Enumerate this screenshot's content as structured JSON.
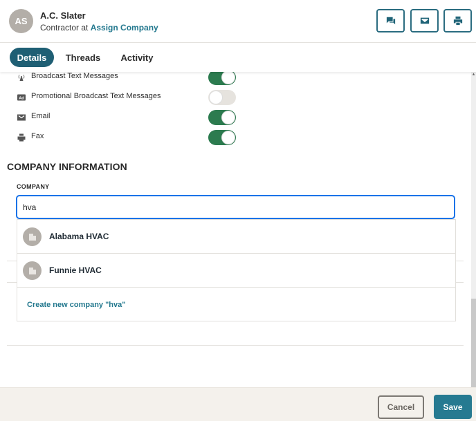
{
  "contact": {
    "initials": "AS",
    "name": "A.C. Slater",
    "role_prefix": "Contractor at ",
    "company_link": "Assign Company"
  },
  "header_actions": [
    {
      "name": "threads",
      "icon": "chat-icon"
    },
    {
      "name": "email",
      "icon": "envelope-icon"
    },
    {
      "name": "print",
      "icon": "printer-icon"
    }
  ],
  "tabs": [
    {
      "label": "Details",
      "active": true
    },
    {
      "label": "Threads",
      "active": false
    },
    {
      "label": "Activity",
      "active": false
    }
  ],
  "preferences": [
    {
      "label": "Broadcast Text Messages",
      "icon": "broadcast-icon",
      "enabled": true
    },
    {
      "label": "Promotional Broadcast Text Messages",
      "icon": "ad-icon",
      "enabled": false
    },
    {
      "label": "Email",
      "icon": "envelope-icon",
      "enabled": true
    },
    {
      "label": "Fax",
      "icon": "printer-icon",
      "enabled": true
    }
  ],
  "company_section": {
    "title": "COMPANY INFORMATION",
    "field_label": "COMPANY",
    "input_value": "hva",
    "suggestions": [
      {
        "name": "Alabama HVAC",
        "icon": "building-icon"
      },
      {
        "name": "Funnie HVAC",
        "icon": "building-icon"
      }
    ],
    "create_label": "Create new company \"hva\""
  },
  "footer": {
    "cancel_label": "Cancel",
    "save_label": "Save"
  },
  "colors": {
    "primary": "#1f5f74",
    "toggle_on": "#2c7b4f",
    "link": "#23788e",
    "focus": "#1a73e8"
  }
}
